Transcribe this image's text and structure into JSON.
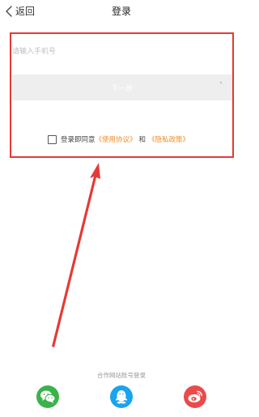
{
  "header": {
    "back_label": "返回",
    "title": "登录"
  },
  "form": {
    "phone_placeholder": "请输入手机号",
    "phone_value": "",
    "next_label": "下一步"
  },
  "agreement": {
    "checked": false,
    "prefix": "登录即同意",
    "terms_link": "《使用协议》",
    "conjunction": "和",
    "privacy_link": "《隐私政策》"
  },
  "partner_login": {
    "label": "合作网站账号登录",
    "providers": [
      {
        "name": "wechat-icon",
        "color": "#3cb24a"
      },
      {
        "name": "qq-icon",
        "color": "#1aa3ee"
      },
      {
        "name": "weibo-icon",
        "color": "#ea4a4a"
      }
    ]
  },
  "annotation": {
    "color": "#e53935"
  }
}
